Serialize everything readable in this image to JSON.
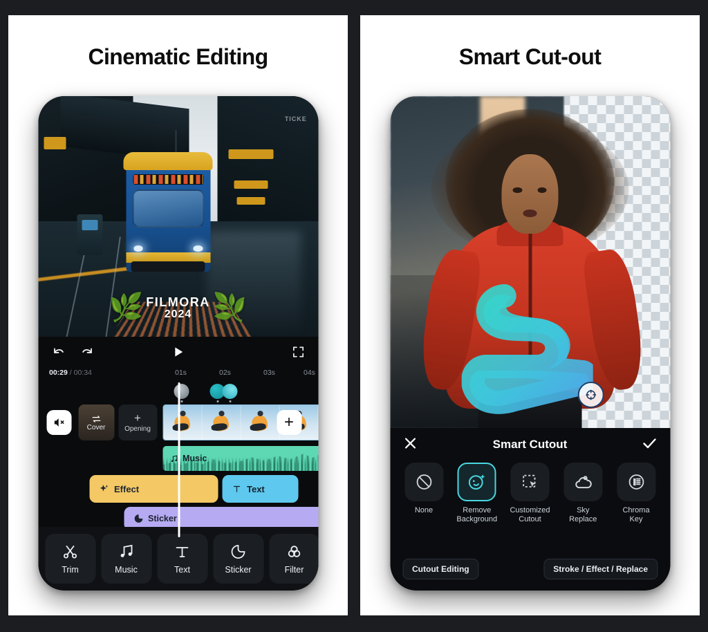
{
  "panels": [
    {
      "title": "Cinematic Editing",
      "preview": {
        "watermark_main": "FILMORA",
        "watermark_year": "2024",
        "ticket_sign": "TICKE"
      },
      "controls": {
        "undo": "undo-icon",
        "redo": "redo-icon",
        "play": "play-icon",
        "fullscreen": "fullscreen-icon"
      },
      "timeline": {
        "current_time": "00:29",
        "separator": " / ",
        "total_time": "00:34",
        "ticks": [
          "01s",
          "02s",
          "03s",
          "04s"
        ]
      },
      "tracks": {
        "mute_icon": "mute-icon",
        "cover_label": "Cover",
        "opening_label": "Opening",
        "add_label": "+",
        "music_label": "Music",
        "effect_label": "Effect",
        "text_label": "Text",
        "sticker_label": "Sticker"
      },
      "toolbar": [
        {
          "label": "Trim",
          "icon": "scissors-icon"
        },
        {
          "label": "Music",
          "icon": "music-note-icon"
        },
        {
          "label": "Text",
          "icon": "text-t-icon"
        },
        {
          "label": "Sticker",
          "icon": "sticker-icon"
        },
        {
          "label": "Filter",
          "icon": "filter-circles-icon"
        }
      ]
    },
    {
      "title": "Smart Cut-out",
      "sheet": {
        "close_icon": "close-x-icon",
        "title": "Smart Cutout",
        "confirm_icon": "check-icon",
        "options": [
          {
            "label": "None",
            "icon": "none-slash-icon",
            "active": false
          },
          {
            "label": "Remove\nBackground",
            "label_line1": "Remove",
            "label_line2": "Background",
            "icon": "remove-background-icon",
            "active": true
          },
          {
            "label": "Customized Cutout",
            "label_line1": "Customized",
            "label_line2": "Cutout",
            "icon": "customized-cutout-icon",
            "active": false
          },
          {
            "label": "Sky Replace",
            "label_line1": "Sky",
            "label_line2": "Replace",
            "icon": "sky-replace-cloud-icon",
            "active": false
          },
          {
            "label": "Chroma Key",
            "label_line1": "Chroma",
            "label_line2": "Key",
            "icon": "chroma-key-icon",
            "active": false
          }
        ],
        "left_button": "Cutout Editing",
        "right_button": "Stroke / Effect / Replace"
      }
    }
  ],
  "colors": {
    "background": "#1b1d20",
    "panel": "#ffffff",
    "accent_teal": "#4ad6e0",
    "music_track": "#5ed8b2",
    "effect_track": "#f3c865",
    "text_track": "#5ec8ee",
    "sticker_track": "#b6aaf3",
    "playhead": "#ffffff"
  }
}
